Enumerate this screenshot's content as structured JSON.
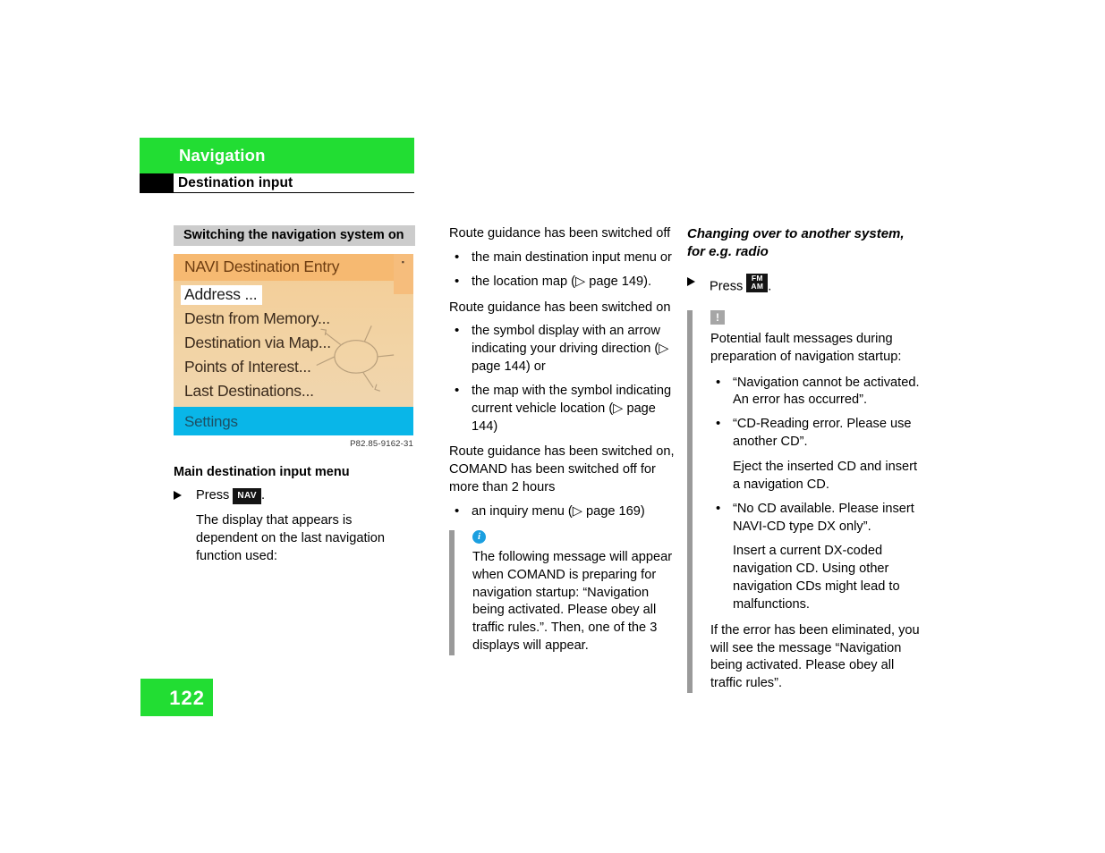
{
  "header": {
    "chapter": "Navigation",
    "section": "Destination input",
    "chapter_band_color": "#22dd33"
  },
  "left_column": {
    "subhead": "Switching the navigation system on",
    "screen": {
      "title": "NAVI Destination Entry",
      "corner_marker": "▪",
      "items": [
        "Address ...",
        "Destn from Memory...",
        "Destination via Map...",
        "Points of Interest...",
        "Last Destinations..."
      ],
      "selected_index": 0,
      "footer_item": "Settings",
      "top_color": "#f6b971",
      "body_color": "#f0d5ad",
      "footer_color": "#09b6e8"
    },
    "figure_credit": "P82.85-9162-31",
    "caption": "Main destination input menu",
    "step_label": "Press",
    "step_key": "NAV",
    "step_period": ".",
    "step_note": "The display that appears is dependent on the last navigation function used:"
  },
  "middle_column": {
    "lead_off": "Route guidance has been switched off",
    "bullets_off": [
      "the main destination input menu or",
      "the location map (▷ page 149)."
    ],
    "lead_on": "Route guidance has been switched on",
    "bullets_on": [
      "the symbol display with an arrow indicating your driving direction (▷ page 144) or",
      "the map with the symbol indicating current vehicle location (▷ page 144)"
    ],
    "lead_2hours": "Route guidance has been switched on, COMAND has been switched off for more than 2 hours",
    "bullets_2hours": [
      "an inquiry menu (▷ page 169)"
    ],
    "info_icon": "i",
    "info_text": "The following message will appear when COMAND is preparing for navigation startup: “Navigation being activated. Please obey all traffic rules.”. Then, one of the 3 displays will appear."
  },
  "right_column": {
    "heading": "Changing over to another system, for e.g. radio",
    "step_label": "Press",
    "step_key_line1": "FM",
    "step_key_line2": "AM",
    "step_period": ".",
    "warn_icon": "!",
    "warn_lead": "Potential fault messages during preparation of navigation startup:",
    "warn_bullets": [
      {
        "text": "“Navigation cannot be activated. An error has occurred”.",
        "sub": ""
      },
      {
        "text": "“CD-Reading error. Please use another CD”.",
        "sub": "Eject the inserted CD and insert a navigation CD."
      },
      {
        "text": "“No CD available. Please insert NAVI-CD type DX only”.",
        "sub": "Insert a current DX-coded navigation CD. Using other navigation CDs might lead to malfunctions."
      }
    ],
    "warn_closing": "If the error has been eliminated, you will see the message “Navigation being activated. Please obey all traffic rules”."
  },
  "footer": {
    "page_number": "122"
  }
}
